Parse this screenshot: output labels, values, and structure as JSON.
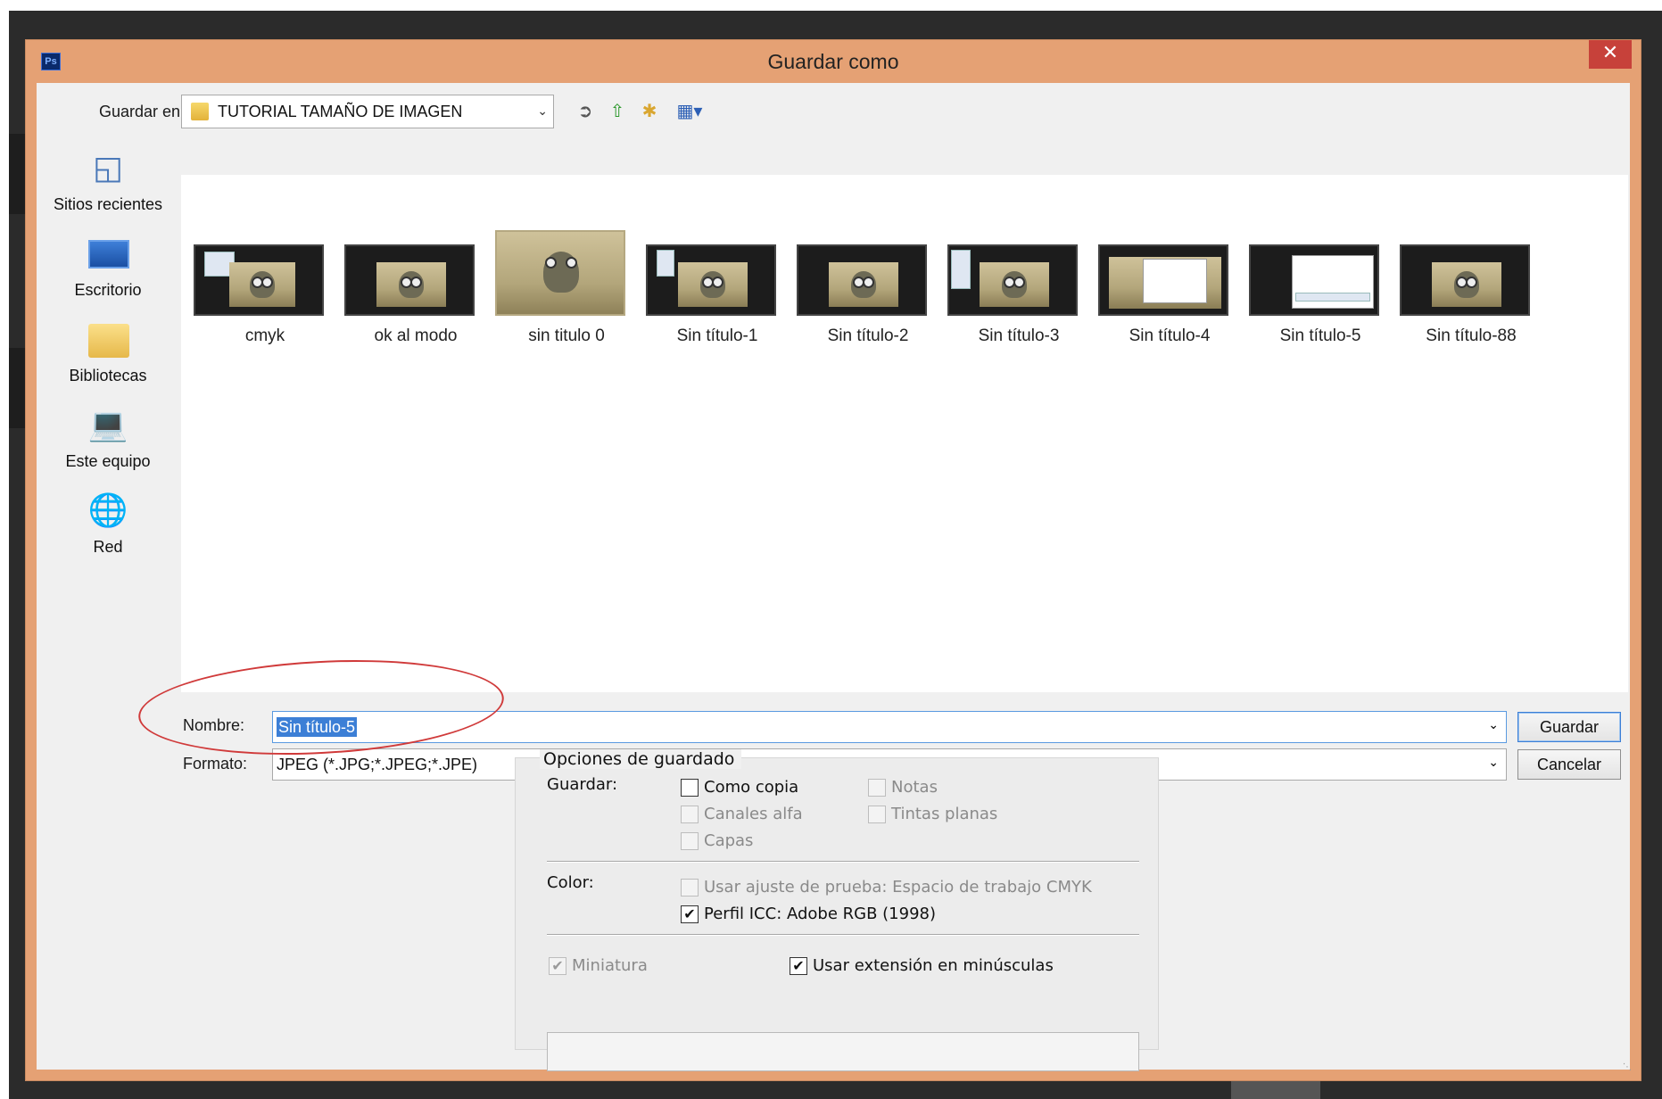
{
  "window": {
    "title": "Guardar como",
    "app_icon": "Ps",
    "close_label": "✕"
  },
  "toolbar": {
    "lookin_label": "Guardar en:",
    "lookin_value": "TUTORIAL TAMAÑO DE IMAGEN",
    "icons": [
      "back-icon",
      "up-folder-icon",
      "new-folder-icon",
      "view-menu-icon"
    ]
  },
  "places": [
    {
      "label": "Sitios recientes",
      "icon": "recent-places-icon"
    },
    {
      "label": "Escritorio",
      "icon": "desktop-icon"
    },
    {
      "label": "Bibliotecas",
      "icon": "libraries-icon"
    },
    {
      "label": "Este equipo",
      "icon": "computer-icon"
    },
    {
      "label": "Red",
      "icon": "network-icon"
    }
  ],
  "files": [
    {
      "name": "cmyk"
    },
    {
      "name": "ok al modo"
    },
    {
      "name": "sin titulo 0"
    },
    {
      "name": "Sin título-1"
    },
    {
      "name": "Sin título-2"
    },
    {
      "name": "Sin título-3"
    },
    {
      "name": "Sin título-4"
    },
    {
      "name": "Sin título-5"
    },
    {
      "name": "Sin título-88"
    }
  ],
  "form": {
    "name_label": "Nombre:",
    "name_value": "Sin título-5",
    "format_label": "Formato:",
    "format_value": "JPEG (*.JPG;*.JPEG;*.JPE)",
    "save_button": "Guardar",
    "cancel_button": "Cancelar"
  },
  "options": {
    "title": "Opciones de guardado",
    "save_label": "Guardar:",
    "como_copia": "Como copia",
    "notas": "Notas",
    "canales_alfa": "Canales alfa",
    "tintas_planas": "Tintas planas",
    "capas": "Capas",
    "color_label": "Color:",
    "usar_ajuste": "Usar ajuste de prueba: Espacio de trabajo CMYK",
    "perfil_icc": "Perfil ICC: Adobe RGB (1998)",
    "miniatura": "Miniatura",
    "usar_extension": "Usar extensión en minúsculas",
    "checked_mark": "✔"
  }
}
